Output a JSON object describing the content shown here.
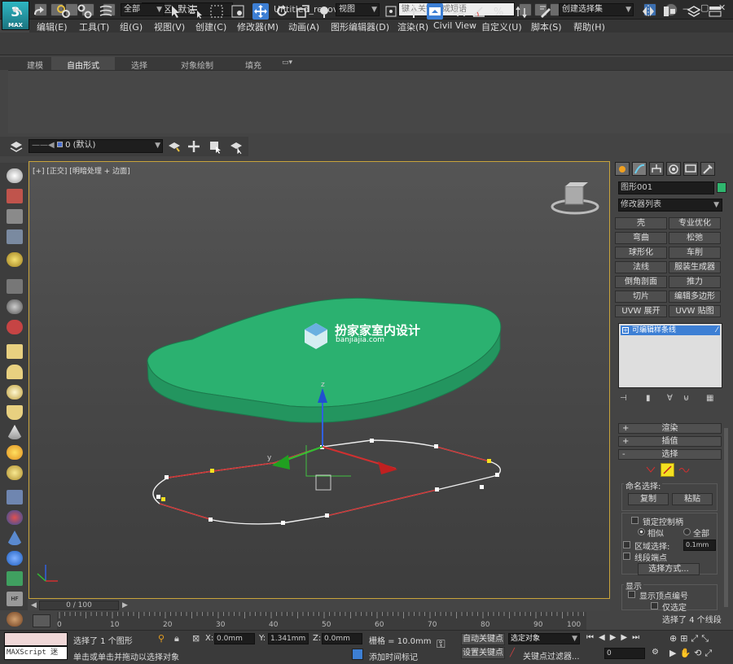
{
  "app": {
    "title": "Untitled_recover.max",
    "logo_text": "3",
    "logo_sub": "MAX",
    "workspace": "工作区: 默认",
    "search_placeholder": "键入关键字或短语",
    "login": "登录"
  },
  "menu": [
    "编辑(E)",
    "工具(T)",
    "组(G)",
    "视图(V)",
    "创建(C)",
    "修改器(M)",
    "动画(A)",
    "图形编辑器(D)",
    "渲染(R)",
    "Civil View",
    "自定义(U)",
    "脚本(S)",
    "帮助(H)"
  ],
  "toolbar": {
    "selection_filter": "全部",
    "ref_coord": "视图",
    "named_selection": "创建选择集"
  },
  "ribbon": {
    "tabs": [
      "建模",
      "自由形式",
      "选择",
      "对象绘制",
      "填充"
    ]
  },
  "layer": {
    "name": "0 (默认)"
  },
  "viewport": {
    "label": "[+] [正交] [明暗处理 + 边面]",
    "watermark_title": "扮家家室内设计",
    "watermark_url": "banjiajia.com"
  },
  "command_panel": {
    "object_name": "图形001",
    "object_color": "#2fb66e",
    "modifier_list": "修改器列表",
    "buttons": [
      [
        "壳",
        "专业优化"
      ],
      [
        "弯曲",
        "松弛"
      ],
      [
        "球形化",
        "车削"
      ],
      [
        "法线",
        "服装生成器"
      ],
      [
        "倒角剖面",
        "推力"
      ],
      [
        "切片",
        "编辑多边形"
      ],
      [
        "UVW 展开",
        "UVW 贴图"
      ]
    ],
    "stack_item": "可编辑样条线",
    "rollouts": {
      "render": "渲染",
      "interp": "插值",
      "selection": "选择"
    },
    "named_sel": "命名选择:",
    "copy": "复制",
    "paste": "粘贴",
    "lock_handles": "锁定控制柄",
    "similar": "相似",
    "all": "全部",
    "area_select": "区域选择:",
    "area_value": "0.1mm",
    "seg_end": "线段端点",
    "select_by": "选择方式...",
    "display": "显示",
    "show_vertex_num": "显示顶点编号",
    "only_selected": "仅选定",
    "selected_info": "选择了 4 个线段"
  },
  "timeline": {
    "frame": "0 / 100",
    "ticks": [
      "0",
      "10",
      "20",
      "30",
      "40",
      "50",
      "60",
      "70",
      "80",
      "90",
      "100"
    ]
  },
  "status": {
    "maxscript": "MAXScript 迷",
    "selected": "选择了 1 个图形",
    "prompt": "单击或单击并拖动以选择对象",
    "x_label": "X:",
    "x_val": "0.0mm",
    "y_label": "Y:",
    "y_val": "1.341mm",
    "z_label": "Z:",
    "z_val": "0.0mm",
    "grid": "栅格 = 10.0mm",
    "add_time_tag": "添加时间标记",
    "auto_key": "自动关键点",
    "set_key": "设置关键点",
    "key_mode": "选定对象",
    "key_filters": "关键点过滤器...",
    "frame_val": "0"
  }
}
